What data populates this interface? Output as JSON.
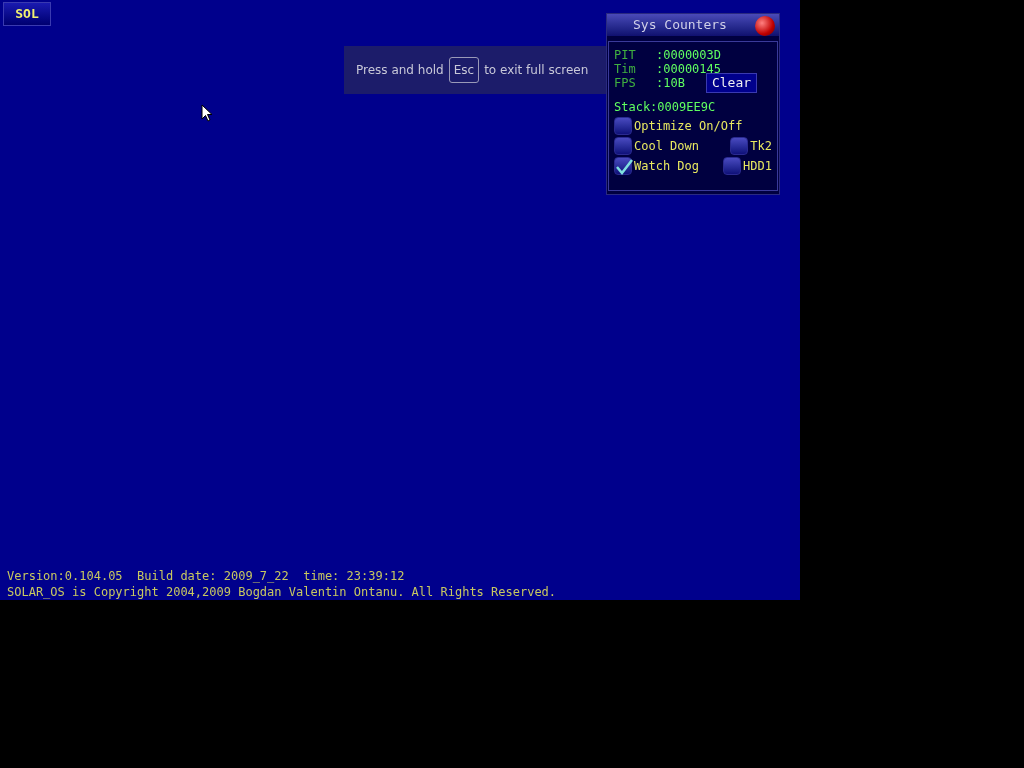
{
  "start_button": "SOL",
  "fullscreen_hint": {
    "before": "Press and hold",
    "key": "Esc",
    "after": "to exit full screen"
  },
  "sys_counters": {
    "title": "Sys Counters",
    "counters": [
      {
        "label": "PIT",
        "value": ":0000003D"
      },
      {
        "label": "Tim",
        "value": ":00000145"
      },
      {
        "label": "FPS",
        "value": ":10B"
      }
    ],
    "clear_button": "Clear",
    "stack": "Stack:0009EE9C",
    "options": [
      {
        "label": "Optimize On/Off",
        "checked": false
      },
      {
        "label": "Cool Down",
        "checked": false
      },
      {
        "label": "Tk2",
        "checked": false
      },
      {
        "label": "Watch Dog",
        "checked": true
      },
      {
        "label": "HDD1",
        "checked": false
      }
    ]
  },
  "footer": [
    "Version:0.104.05  Build date: 2009_7_22  time: 23:39:12",
    "SOLAR_OS is Copyright 2004,2009 Bogdan Valentin Ontanu. All Rights Reserved."
  ]
}
